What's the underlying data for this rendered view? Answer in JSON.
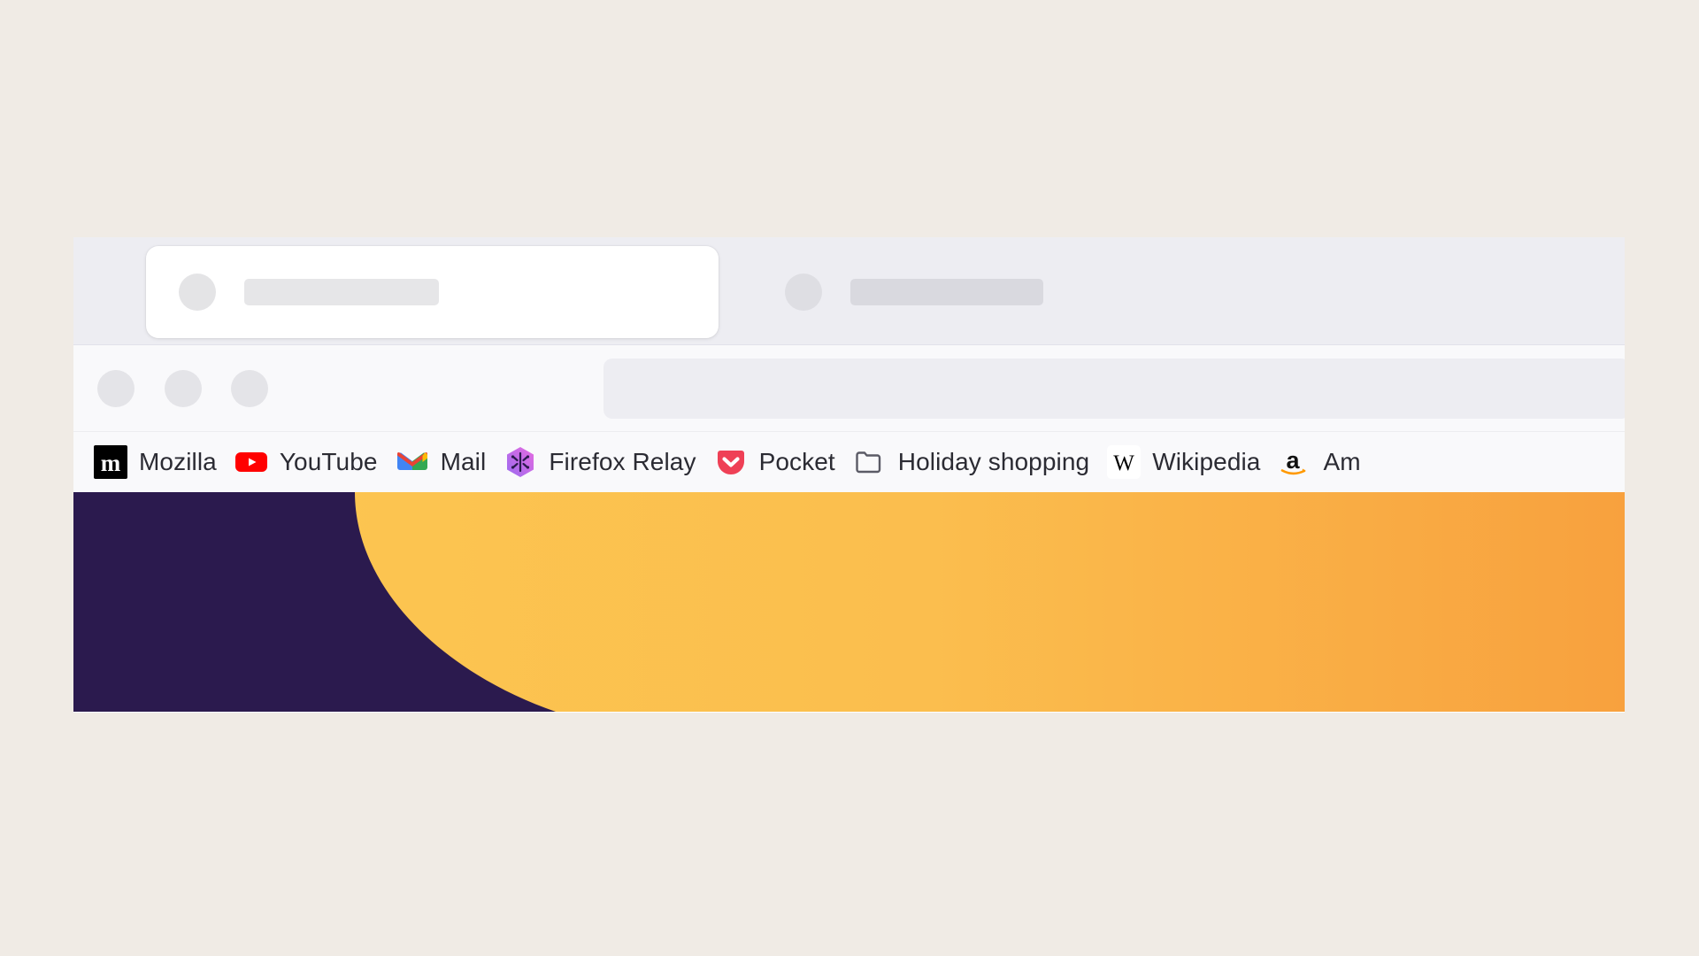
{
  "window": {
    "background_color": "#F0EBE5",
    "chrome_color": "#EDEDF2",
    "toolbar_color": "#F9F9FB"
  },
  "tabs": [
    {
      "name": "tab-active",
      "state": "active",
      "label": "",
      "placeholder": true
    },
    {
      "name": "tab-inactive",
      "state": "inactive",
      "label": "",
      "placeholder": true
    }
  ],
  "toolbar": {
    "back_label": "",
    "forward_label": "",
    "reload_label": "",
    "urlbar_value": "",
    "urlbar_placeholder": ""
  },
  "bookmarks": {
    "items": [
      {
        "label": "Mozilla",
        "icon": "mozilla-icon"
      },
      {
        "label": "YouTube",
        "icon": "youtube-icon"
      },
      {
        "label": "Mail",
        "icon": "gmail-icon"
      },
      {
        "label": "Firefox Relay",
        "icon": "firefox-relay-icon"
      },
      {
        "label": "Pocket",
        "icon": "pocket-icon"
      },
      {
        "label": "Holiday shopping",
        "icon": "folder-icon"
      },
      {
        "label": "Wikipedia",
        "icon": "wikipedia-icon"
      },
      {
        "label": "Am",
        "icon": "amazon-icon"
      }
    ]
  },
  "content": {
    "purple": "#2B1A4E",
    "yellow": "#FCC850",
    "orange": "#F9A13F"
  }
}
